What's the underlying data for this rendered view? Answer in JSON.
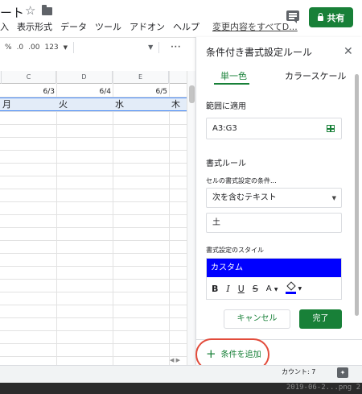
{
  "header": {
    "doc_title": "ート",
    "share_label": "共有",
    "last_edit": "変更内容をすべてD...",
    "menu": [
      "入",
      "表示形式",
      "データ",
      "ツール",
      "アドオン",
      "ヘルプ"
    ]
  },
  "toolbar": {
    "percent": "%",
    "decrease_decimals": ".0",
    "increase_decimals": ".00",
    "number_format": "123",
    "more": "···"
  },
  "sheet": {
    "columns": [
      "C",
      "D",
      "E"
    ],
    "dates": [
      "6/3",
      "6/4",
      "6/5"
    ],
    "days": [
      "月",
      "火",
      "水",
      "木"
    ],
    "count_label": "カウント: 7"
  },
  "panel": {
    "title": "条件付き書式設定ルール",
    "tab_single": "単一色",
    "tab_scale": "カラースケール",
    "range_label": "範囲に適用",
    "range_value": "A3:G3",
    "rules_label": "書式ルール",
    "condition_label": "セルの書式設定の条件...",
    "condition_value": "次を含むテキスト",
    "value": "土",
    "style_label": "書式設定のスタイル",
    "style_name": "カスタム",
    "cancel": "キャンセル",
    "done": "完了",
    "add_rule": "条件を追加"
  },
  "watermark": "2019-06-2...png  2",
  "colors": {
    "accent_green": "#188038",
    "custom_fill": "#0000ff",
    "highlight_ring": "#e24b3b"
  },
  "icons": [
    "star-icon",
    "folder-icon",
    "comment-icon",
    "lock-icon",
    "close-icon",
    "table-icon",
    "bold-icon",
    "italic-icon",
    "underline-icon",
    "strike-icon",
    "text-color-icon",
    "fill-color-icon",
    "plus-icon",
    "explore-icon"
  ]
}
